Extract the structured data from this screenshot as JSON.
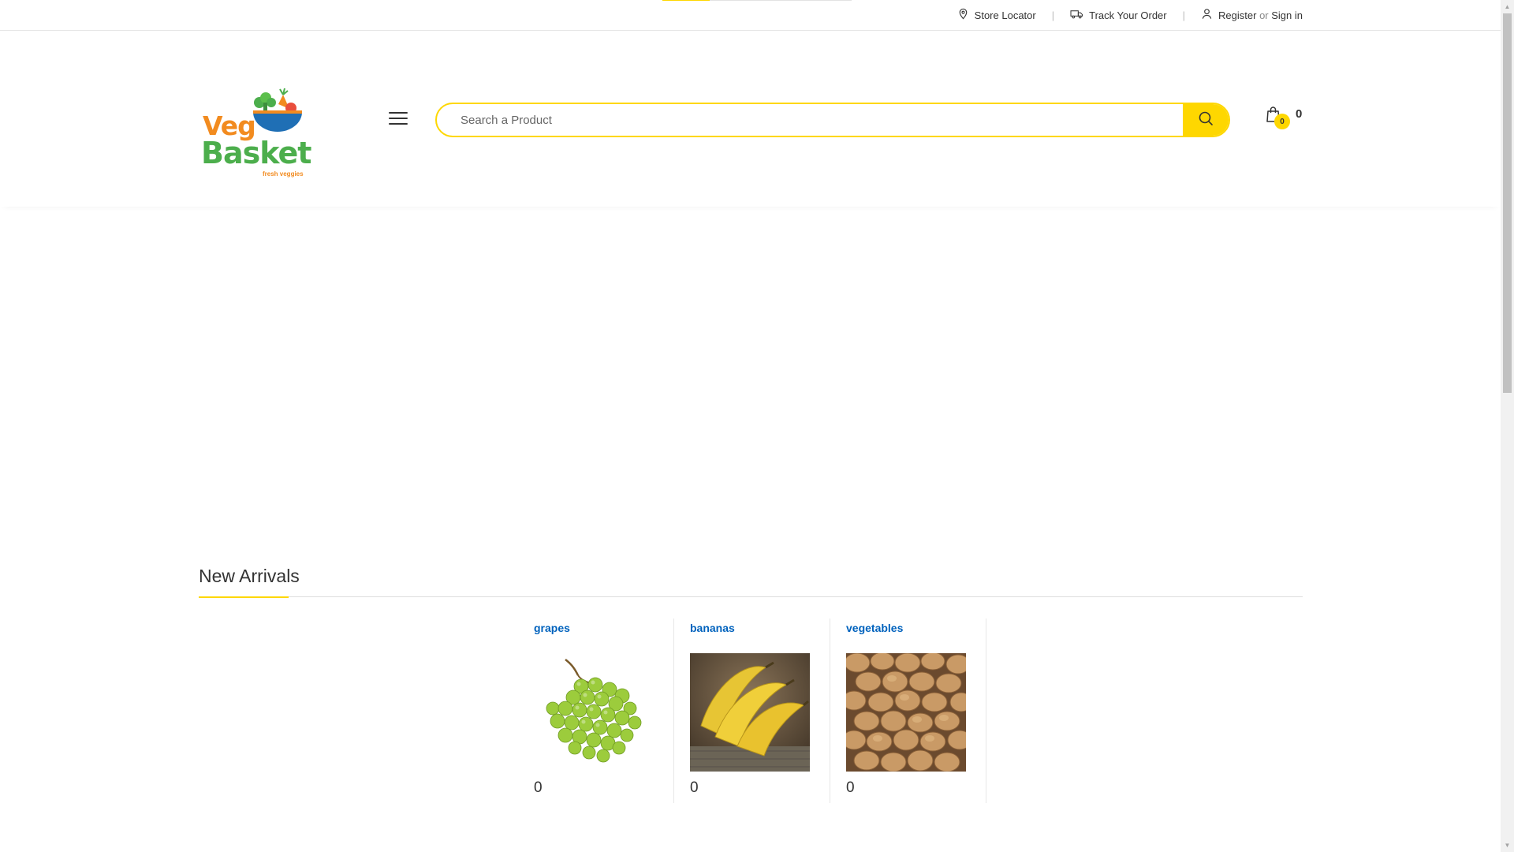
{
  "topbar": {
    "progress": 0.25,
    "store_locator": "Store Locator",
    "track_order": "Track Your Order",
    "register": "Register",
    "or": "or",
    "sign_in": "Sign in",
    "separator": "|"
  },
  "logo": {
    "line1": "Veg",
    "line2": "Basket",
    "tagline": "fresh veggies"
  },
  "search": {
    "placeholder": "Search a Product",
    "value": ""
  },
  "cart": {
    "count": "0",
    "total": "0"
  },
  "new_arrivals": {
    "title": "New Arrivals",
    "products": [
      {
        "name": "grapes",
        "price": "0"
      },
      {
        "name": "bananas",
        "price": "0"
      },
      {
        "name": "vegetables",
        "price": "0"
      }
    ]
  },
  "colors": {
    "accent": "#fed700",
    "link": "#0062bd",
    "logo_orange": "#f28b1f",
    "logo_green": "#4cae4c"
  },
  "icons": [
    "map-pin-icon",
    "truck-icon",
    "user-icon",
    "menu-icon",
    "search-icon",
    "shopping-bag-icon"
  ]
}
